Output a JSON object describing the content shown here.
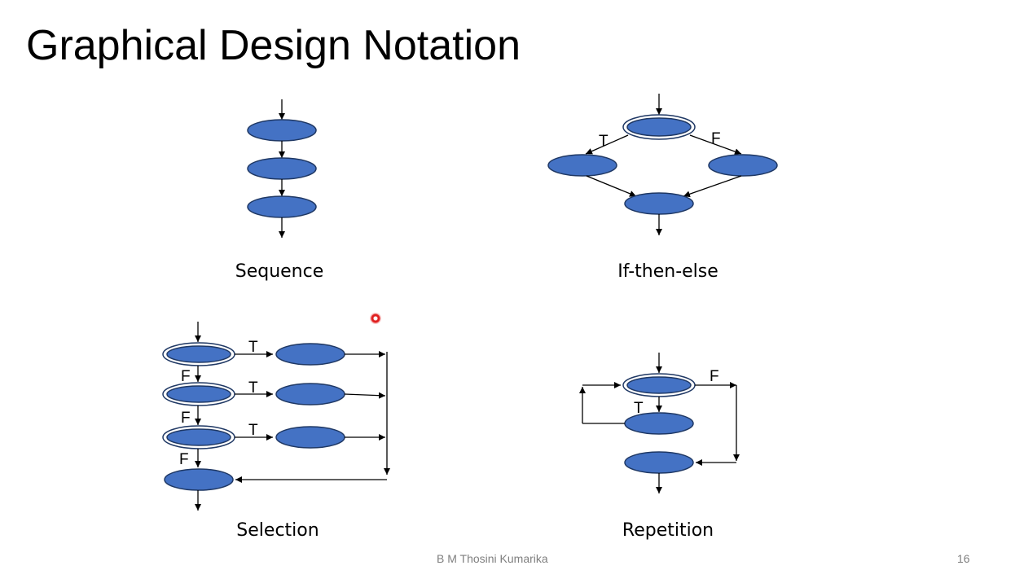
{
  "slide": {
    "title": "Graphical Design Notation",
    "author": "B M Thosini Kumarika",
    "page_number": "16"
  },
  "diagrams": {
    "sequence": {
      "caption": "Sequence"
    },
    "if_then_else": {
      "caption": "If-then-else",
      "true_label": "T",
      "false_label": "F"
    },
    "selection": {
      "caption": "Selection",
      "true_label": "T",
      "false_label": "F"
    },
    "repetition": {
      "caption": "Repetition",
      "true_label": "T",
      "false_label": "F"
    }
  },
  "colors": {
    "node_fill": "#4472c4",
    "node_stroke": "#1f3864",
    "edge": "#000000"
  }
}
